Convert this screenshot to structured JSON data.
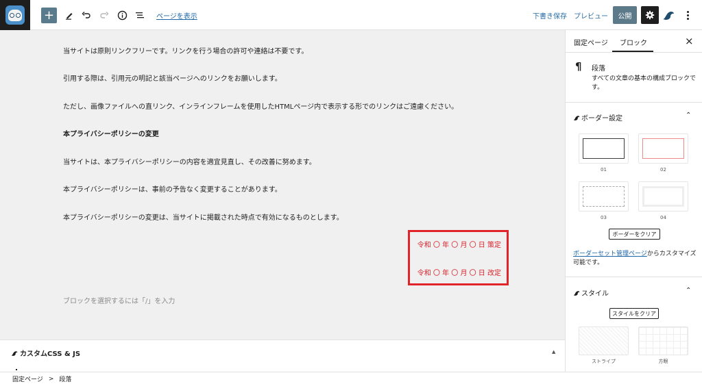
{
  "toolbar": {
    "view_page_label": "ページを表示",
    "draft_save_label": "下書き保存",
    "preview_label": "プレビュー",
    "publish_label": "公開"
  },
  "editor": {
    "paragraphs": [
      "当サイトは原則リンクフリーです。リンクを行う場合の許可や連絡は不要です。",
      "引用する際は、引用元の明記と該当ページへのリンクをお願いします。",
      "ただし、画像ファイルへの直リンク、インラインフレームを使用したHTMLページ内で表示する形でのリンクはご遠慮ください。",
      "本プライバシーポリシーの変更",
      "当サイトは、本プライバシーポリシーの内容を適宜見直し、その改善に努めます。",
      "本プライバシーポリシーは、事前の予告なく変更することがあります。",
      "本プライバシーポリシーの変更は、当サイトに掲載された時点で有効になるものとします。"
    ],
    "date_established": "令和 〇 年 〇 月 〇 日 策定",
    "date_revised": "令和 〇 年 〇 月 〇 日 改定",
    "placeholder": "ブロックを選択するには「/」を入力"
  },
  "metabox": {
    "title": "カスタムCSS & JS"
  },
  "sidebar": {
    "tab_page": "固定ページ",
    "tab_block": "ブロック",
    "block_name": "段落",
    "block_description": "すべての文章の基本の構成ブロックです。",
    "border_panel_title": "ボーダー設定",
    "border_options": [
      "01",
      "02",
      "03",
      "04"
    ],
    "clear_border_label": "ボーダーをクリア",
    "note_link": "ボーダーセット管理ページ",
    "note_text": "からカスタマイズ可能です。",
    "style_panel_title": "スタイル",
    "clear_style_label": "スタイルをクリア",
    "style_options": [
      "ストライプ",
      "方眼"
    ]
  },
  "breadcrumb": {
    "items": [
      "固定ページ",
      "段落"
    ],
    "separator": ">"
  },
  "colors": {
    "accent_red": "#e0242a",
    "link_blue": "#1c66a8",
    "publish_bg": "#5d7a8a"
  }
}
